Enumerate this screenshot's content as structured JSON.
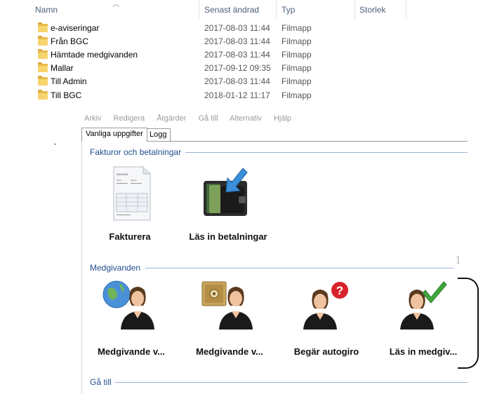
{
  "explorer": {
    "columns": {
      "name": "Namn",
      "modified": "Senast ändrad",
      "type": "Typ",
      "size": "Storlek"
    },
    "rows": [
      {
        "name": "e-aviseringar",
        "modified": "2017-08-03 11:44",
        "type": "Filmapp"
      },
      {
        "name": "Från BGC",
        "modified": "2017-08-03 11:44",
        "type": "Filmapp"
      },
      {
        "name": "Hämtade medgivanden",
        "modified": "2017-08-03 11:44",
        "type": "Filmapp"
      },
      {
        "name": "Mallar",
        "modified": "2017-09-12 09:35",
        "type": "Filmapp"
      },
      {
        "name": "Till Admin",
        "modified": "2017-08-03 11:44",
        "type": "Filmapp"
      },
      {
        "name": "Till BGC",
        "modified": "2018-01-12 11:17",
        "type": "Filmapp"
      }
    ]
  },
  "app": {
    "menu": [
      "Arkiv",
      "Redigera",
      "Åtgärder",
      "Gå till",
      "Alternativ",
      "Hjälp"
    ],
    "tabs": [
      "Vanliga uppgifter",
      "Logg"
    ],
    "groups": {
      "fakturor": {
        "title": "Fakturor och betalningar",
        "items": [
          "Fakturera",
          "Läs in betalningar"
        ],
        "invoice_icon_text": {
          "line1": "INVOICE",
          "line2a": "bill to",
          "line2b": "ship to"
        }
      },
      "medgivanden": {
        "title": "Medgivanden",
        "items": [
          "Medgivande v...",
          "Medgivande v...",
          "Begär autogiro",
          "Läs in medgiv..."
        ]
      },
      "ga_till": {
        "title": "Gå till"
      }
    },
    "overlay_digit": "1"
  },
  "colors": {
    "group_title": "#1f4e8c",
    "folder": "#f7d46e",
    "red_badge": "#d9232b",
    "green_check": "#3ea83a"
  }
}
